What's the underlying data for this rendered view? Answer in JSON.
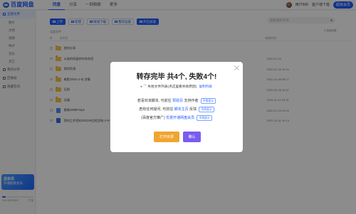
{
  "app": {
    "logo_text": "百度网盘"
  },
  "nav": {
    "items": [
      "同盘",
      "分享",
      "一刻相册",
      "更多"
    ],
    "active": 0
  },
  "user": {
    "name": "用户506",
    "sub_link": "客户端下载",
    "vip_button": "超级会员"
  },
  "sidebar": {
    "items": [
      {
        "label": "全部文件",
        "active": true
      },
      {
        "label": "图片",
        "sub": true
      },
      {
        "label": "文档",
        "sub": true
      },
      {
        "label": "视频",
        "sub": true
      },
      {
        "label": "种子",
        "sub": true
      },
      {
        "label": "音乐",
        "sub": true
      },
      {
        "label": "其它",
        "sub": true
      },
      {
        "label": "我的分享"
      },
      {
        "label": "回收站"
      },
      {
        "label": "隐藏空间"
      }
    ],
    "promo": {
      "title": "送会员",
      "text": "开通超级会员"
    },
    "storage": {
      "used": "242.3G/2055G",
      "expand": "扩容",
      "used_fraction": 0.12
    }
  },
  "toolbar": {
    "buttons": [
      "上传",
      "新建",
      "离线下载",
      "我的设备",
      "开启加速"
    ],
    "search_placeholder": "搜索我的文件"
  },
  "breadcrumb": "全部文件",
  "sort_label": "已全部加载",
  "table": {
    "headers": {
      "name": "文件名",
      "time": "修改时间"
    },
    "rows": [
      {
        "name": "我的分享",
        "time": "",
        "type": "folder"
      },
      {
        "name": "从谁的网盘转存的东西",
        "time": "2022-07-24",
        "type": "folder"
      },
      {
        "name": "我的资源",
        "time": "2022-07-26 19:21",
        "type": "folder"
      },
      {
        "name": "电影(2021-1-6) 合集",
        "time": "2022-11-08 08:17",
        "type": "folder"
      },
      {
        "name": "日剧",
        "time": "2022-02-06 19:37",
        "type": "folder"
      },
      {
        "name": "动漫",
        "time": "2019-11-23 23:31",
        "type": "folder"
      },
      {
        "name": "猫咪1080P.mp4",
        "time": "2022-07-24 19:21",
        "type": "video"
      },
      {
        "name": "我的工作资料202109日程总结-1-9-7.docx",
        "time": "2022-10-31 19:13",
        "type": "doc"
      }
    ]
  },
  "modal": {
    "title": "转存完毕 共4个, 失败4个!",
    "failed_list_label": "失败文件列表(点这里看失败原因)",
    "copy_link": "复制列表",
    "line1_prefix": "若喜欢该脚本, 可前往",
    "line1_link": "赞助页",
    "line1_suffix": "支持作者",
    "line2_prefix": "若有任何疑问, 可前往",
    "line2_link": "脚本主页",
    "line2_suffix": "反馈",
    "line3_prefix": "(百度官方推广)",
    "line3_link": "优惠开通网盘会员",
    "no_more_label": "不再显示",
    "open_dir_button": "打开目录",
    "confirm_button": "确认"
  },
  "colors": {
    "accent": "#1e5eff",
    "open_button": "#f0a530",
    "confirm_button": "#7a5cf0"
  }
}
